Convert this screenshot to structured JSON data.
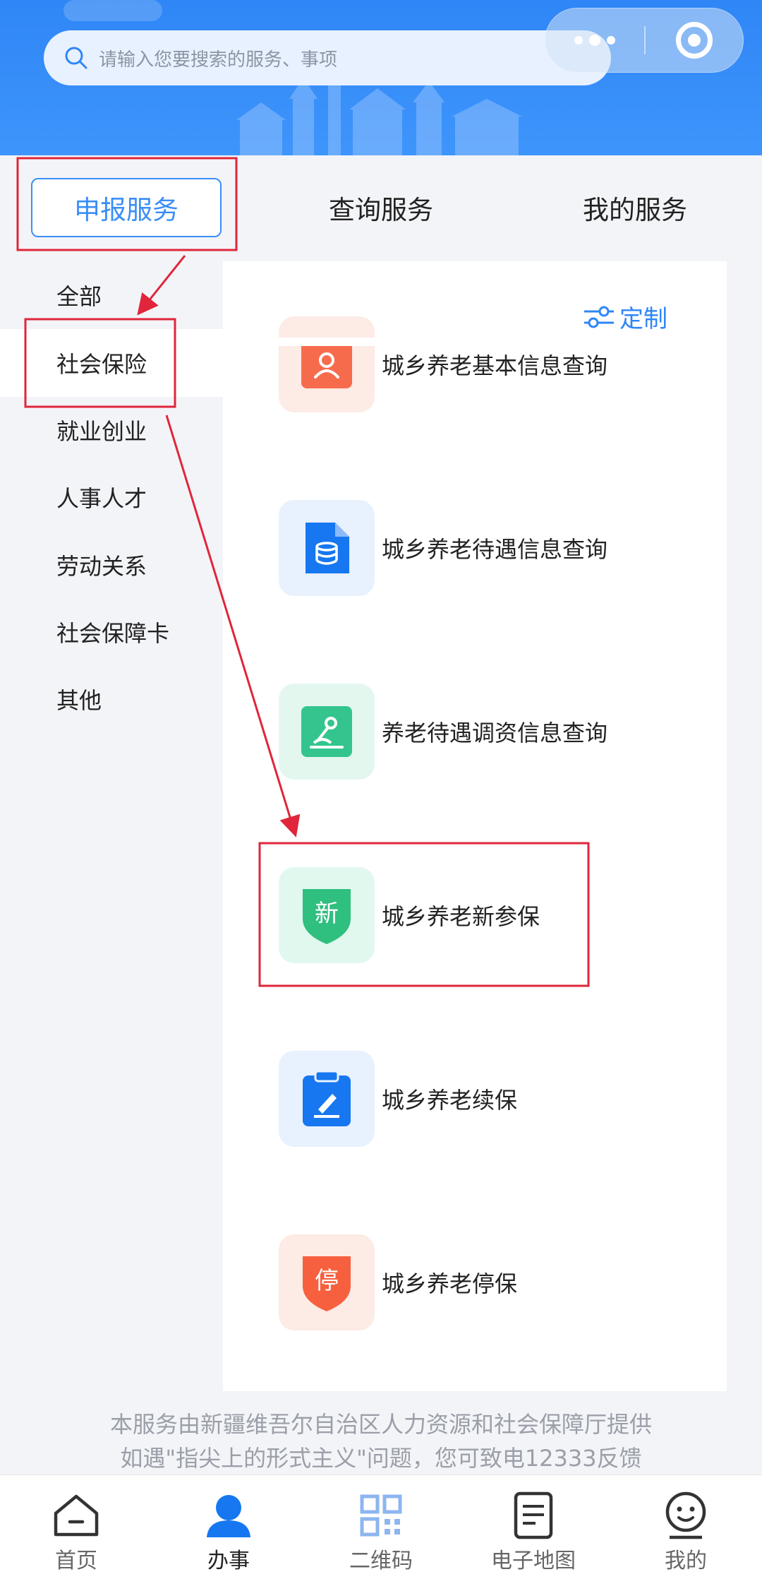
{
  "search": {
    "placeholder": "请输入您要搜索的服务、事项"
  },
  "tabs": [
    {
      "label": "申报服务",
      "active": true
    },
    {
      "label": "查询服务",
      "active": false
    },
    {
      "label": "我的服务",
      "active": false
    }
  ],
  "categories": [
    {
      "label": "全部"
    },
    {
      "label": "社会保险",
      "active": true
    },
    {
      "label": "就业创业"
    },
    {
      "label": "人事人才"
    },
    {
      "label": "劳动关系"
    },
    {
      "label": "社会保障卡"
    },
    {
      "label": "其他"
    }
  ],
  "custom_label": "定制",
  "services": [
    {
      "label": "城乡养老基本信息查询",
      "icon": "person-card-icon",
      "color": "#f76b4d",
      "bg": "#fdebe5"
    },
    {
      "label": "城乡养老待遇信息查询",
      "icon": "document-coins-icon",
      "color": "#1677f0",
      "bg": "#e8f1fe"
    },
    {
      "label": "养老待遇调资信息查询",
      "icon": "adjust-icon",
      "color": "#34c58e",
      "bg": "#e3f7ef"
    },
    {
      "label": "城乡养老新参保",
      "icon": "shield-icon",
      "glyph": "新",
      "color": "#2fbf7f",
      "bg": "#e1f8ef"
    },
    {
      "label": "城乡养老续保",
      "icon": "clipboard-edit-icon",
      "color": "#1677f0",
      "bg": "#e8f1fe"
    },
    {
      "label": "城乡养老停保",
      "icon": "shield-icon",
      "glyph": "停",
      "color": "#f7603e",
      "bg": "#fdebe5"
    }
  ],
  "footer": {
    "line1": "本服务由新疆维吾尔自治区人力资源和社会保障厅提供",
    "line2": "如遇\"指尖上的形式主义\"问题，您可致电12333反馈"
  },
  "nav": [
    {
      "label": "首页",
      "icon": "home-icon"
    },
    {
      "label": "办事",
      "icon": "user-icon",
      "active": true
    },
    {
      "label": "二维码",
      "icon": "qrcode-icon"
    },
    {
      "label": "电子地图",
      "icon": "map-doc-icon"
    },
    {
      "label": "我的",
      "icon": "smile-icon"
    }
  ],
  "colors": {
    "primary": "#2f86f6",
    "annotation": "#e0263a",
    "background": "#f3f4f8"
  }
}
